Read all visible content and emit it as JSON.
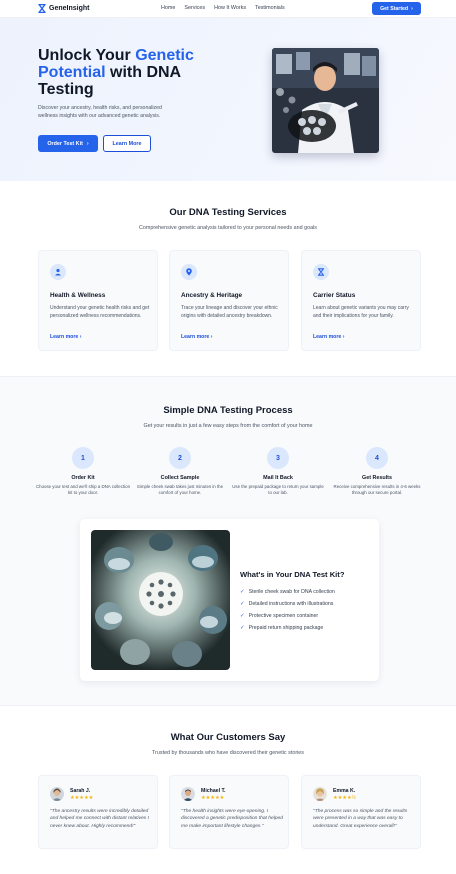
{
  "nav": {
    "brand": "GeneInsight",
    "links": [
      "Home",
      "Services",
      "How It Works",
      "Testimonials"
    ],
    "cta": "Get Started"
  },
  "hero": {
    "title_part1": "Unlock Your ",
    "title_accent": "Genetic Potential",
    "title_part2": " with DNA Testing",
    "subtitle": "Discover your ancestry, health risks, and personalized wellness insights with our advanced genetic analysis.",
    "primary_button": "Order Test Kit",
    "secondary_button": "Learn More"
  },
  "services": {
    "title": "Our DNA Testing Services",
    "subtitle": "Comprehensive genetic analysis tailored to your personal needs and goals",
    "cards": [
      {
        "title": "Health & Wellness",
        "description": "Understand your genetic health risks and get personalized wellness recommendations.",
        "link": "Learn more",
        "icon": "person-icon"
      },
      {
        "title": "Ancestry & Heritage",
        "description": "Trace your lineage and discover your ethnic origins with detailed ancestry breakdown.",
        "link": "Learn more",
        "icon": "map-pin-icon"
      },
      {
        "title": "Carrier Status",
        "description": "Learn about genetic variants you may carry and their implications for your family.",
        "link": "Learn more",
        "icon": "dna-icon"
      }
    ]
  },
  "process": {
    "title": "Simple DNA Testing Process",
    "subtitle": "Get your results in just a few easy steps from the comfort of your home",
    "steps": [
      {
        "number": "1",
        "title": "Order Kit",
        "description": "Choose your test and we'll ship a DNA collection kit to your door."
      },
      {
        "number": "2",
        "title": "Collect Sample",
        "description": "Simple cheek swab takes just minutes in the comfort of your home."
      },
      {
        "number": "3",
        "title": "Mail It Back",
        "description": "Use the prepaid package to return your sample to our lab."
      },
      {
        "number": "4",
        "title": "Get Results",
        "description": "Receive comprehensive results in 4-6 weeks through our secure portal."
      }
    ],
    "kit": {
      "title": "What's in Your DNA Test Kit?",
      "items": [
        "Sterile cheek swab for DNA collection",
        "Detailed instructions with illustrations",
        "Protective specimen container",
        "Prepaid return shipping package"
      ]
    }
  },
  "testimonials": {
    "title": "What Our Customers Say",
    "subtitle": "Trusted by thousands who have discovered their genetic stories",
    "items": [
      {
        "name": "Sarah J.",
        "stars": "★★★★★",
        "rating": 5,
        "quote": "\"The ancestry results were incredibly detailed and helped me connect with distant relatives I never knew about. Highly recommend!\""
      },
      {
        "name": "Michael T.",
        "stars": "★★★★★",
        "rating": 5,
        "quote": "\"The health insights were eye-opening. I discovered a genetic predisposition that helped me make important lifestyle changes.\""
      },
      {
        "name": "Emma K.",
        "stars": "★★★★½",
        "rating": 4.5,
        "quote": "\"The process was so simple and the results were presented in a way that was easy to understand. Great experience overall!\""
      }
    ]
  },
  "colors": {
    "accent": "#2563eb",
    "heading": "#111827",
    "text": "#4b5563",
    "star": "#f5b301"
  }
}
